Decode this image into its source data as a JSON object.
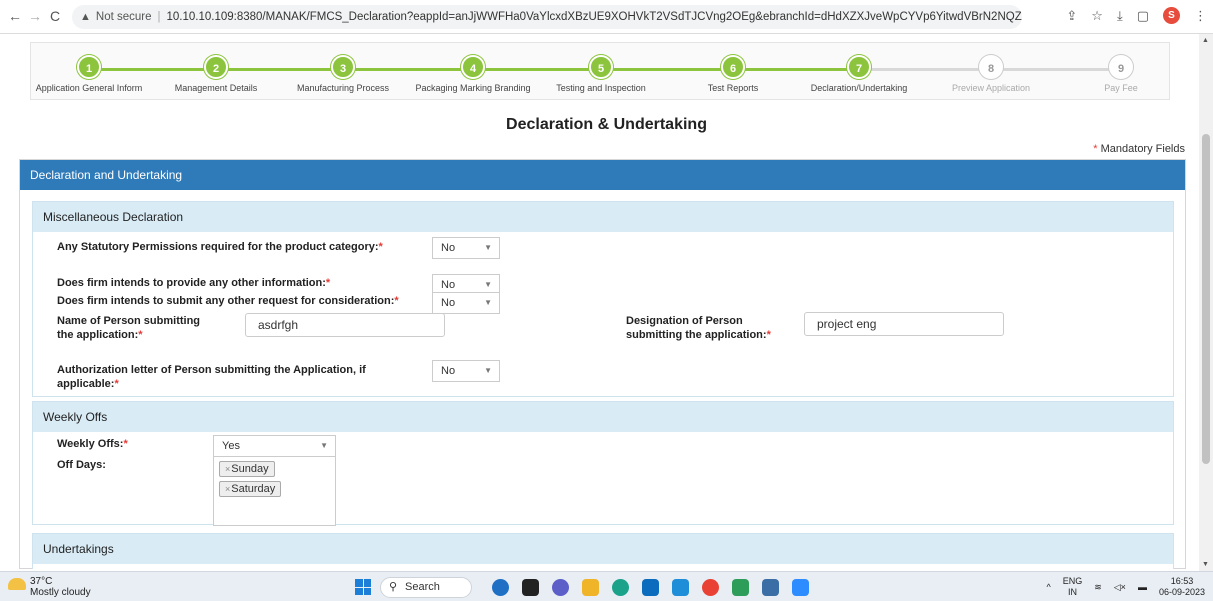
{
  "browser": {
    "url_warning": "Not secure",
    "url": "10.10.10.109:8380/MANAK/FMCS_Declaration?eappId=anJjWWFHa0VaYlcxdXBzUE9XOHVkT2VSdTJCVng2OEg&ebranchId=dHdXZXJveWpCYVp6YitwdVBrN2NQZz09",
    "profile_initial": "S"
  },
  "steps": [
    {
      "num": "1",
      "label": "Application General Inform",
      "done": true
    },
    {
      "num": "2",
      "label": "Management Details",
      "done": true
    },
    {
      "num": "3",
      "label": "Manufacturing Process",
      "done": true
    },
    {
      "num": "4",
      "label": "Packaging Marking Branding",
      "done": true
    },
    {
      "num": "5",
      "label": "Testing and Inspection",
      "done": true
    },
    {
      "num": "6",
      "label": "Test Reports",
      "done": true
    },
    {
      "num": "7",
      "label": "Declaration/Undertaking",
      "done": true
    },
    {
      "num": "8",
      "label": "Preview Application",
      "done": false
    },
    {
      "num": "9",
      "label": "Pay Fee",
      "done": false
    }
  ],
  "page": {
    "title": "Declaration & Undertaking",
    "mandatory_note": "Mandatory Fields",
    "panel_title": "Declaration and Undertaking"
  },
  "misc": {
    "title": "Miscellaneous Declaration",
    "statutory_label": "Any Statutory Permissions required for the product category:",
    "statutory_value": "No",
    "other_info_label": "Does firm intends to provide any other information:",
    "other_info_value": "No",
    "other_request_label": "Does firm intends to submit any other request for consideration:",
    "other_request_value": "No",
    "person_name_label_1": "Name of Person submitting",
    "person_name_label_2": "the application:",
    "person_name_value": "asdrfgh",
    "designation_label_1": "Designation of Person",
    "designation_label_2": "submitting the application:",
    "designation_value": "project eng",
    "auth_letter_label_1": "Authorization letter of Person submitting the Application, if",
    "auth_letter_label_2": "applicable:",
    "auth_letter_value": "No"
  },
  "weekly": {
    "title": "Weekly Offs",
    "weekly_offs_label": "Weekly Offs:",
    "weekly_offs_value": "Yes",
    "off_days_label": "Off Days:",
    "off_days": [
      "Sunday",
      "Saturday"
    ]
  },
  "undertakings": {
    "title": "Undertakings"
  },
  "taskbar": {
    "temperature": "37°C",
    "weather": "Mostly cloudy",
    "search": "Search",
    "lang_1": "ENG",
    "lang_2": "IN",
    "time": "16:53",
    "date": "06-09-2023"
  },
  "colors": {
    "accent": "#2f7ab8",
    "step_done": "#8cc43d",
    "required": "#e53935"
  }
}
